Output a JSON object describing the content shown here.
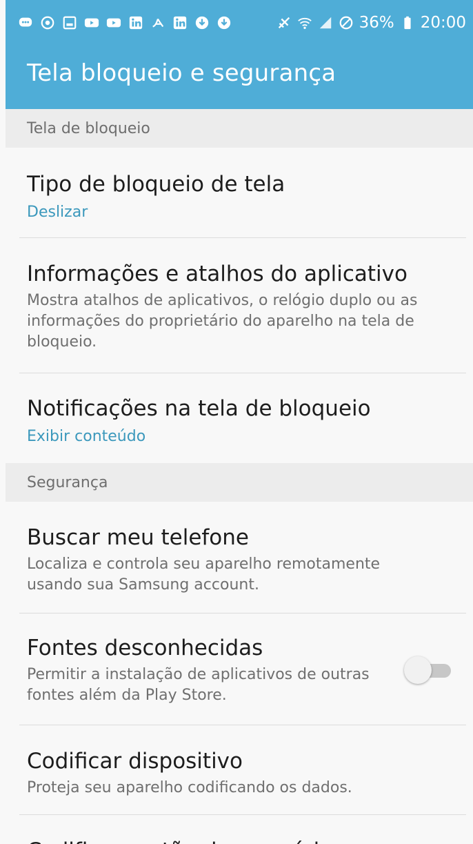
{
  "status_bar": {
    "battery": "36%",
    "time": "20:00",
    "left_icons": [
      "chat-icon",
      "clock-icon",
      "gallery-icon",
      "youtube-icon",
      "youtube-icon",
      "linkedin-icon",
      "app-icon",
      "linkedin-icon",
      "download-icon",
      "download-icon"
    ],
    "right_icons": [
      "mute-icon",
      "wifi-icon",
      "signal-icon",
      "blocked-icon",
      "battery-icon"
    ]
  },
  "header": {
    "title": "Tela bloqueio e segurança"
  },
  "sections": [
    {
      "label": "Tela de bloqueio",
      "items": [
        {
          "title": "Tipo de bloqueio de tela",
          "subtitle": "Deslizar",
          "accent": true
        },
        {
          "title": "Informações e atalhos do aplicativo",
          "subtitle": "Mostra atalhos de aplicativos, o relógio duplo ou as informações do proprietário do aparelho na tela de bloqueio.",
          "accent": false
        },
        {
          "title": "Notificações na tela de bloqueio",
          "subtitle": "Exibir conteúdo",
          "accent": true
        }
      ]
    },
    {
      "label": "Segurança",
      "items": [
        {
          "title": "Buscar meu telefone",
          "subtitle": "Localiza e controla seu aparelho remotamente usando sua Samsung account.",
          "accent": false
        },
        {
          "title": "Fontes desconhecidas",
          "subtitle": "Permitir a instalação de aplicativos de outras fontes além da Play Store.",
          "accent": false,
          "toggle": false
        },
        {
          "title": "Codificar dispositivo",
          "subtitle": "Proteja seu aparelho codificando os dados.",
          "accent": false
        },
        {
          "title": "Codificar cartão de memória",
          "subtitle": "",
          "accent": false
        }
      ]
    }
  ],
  "colors": {
    "appbar": "#4fadd7",
    "accent_text": "#3b98bc",
    "section_bg": "#ececec"
  }
}
